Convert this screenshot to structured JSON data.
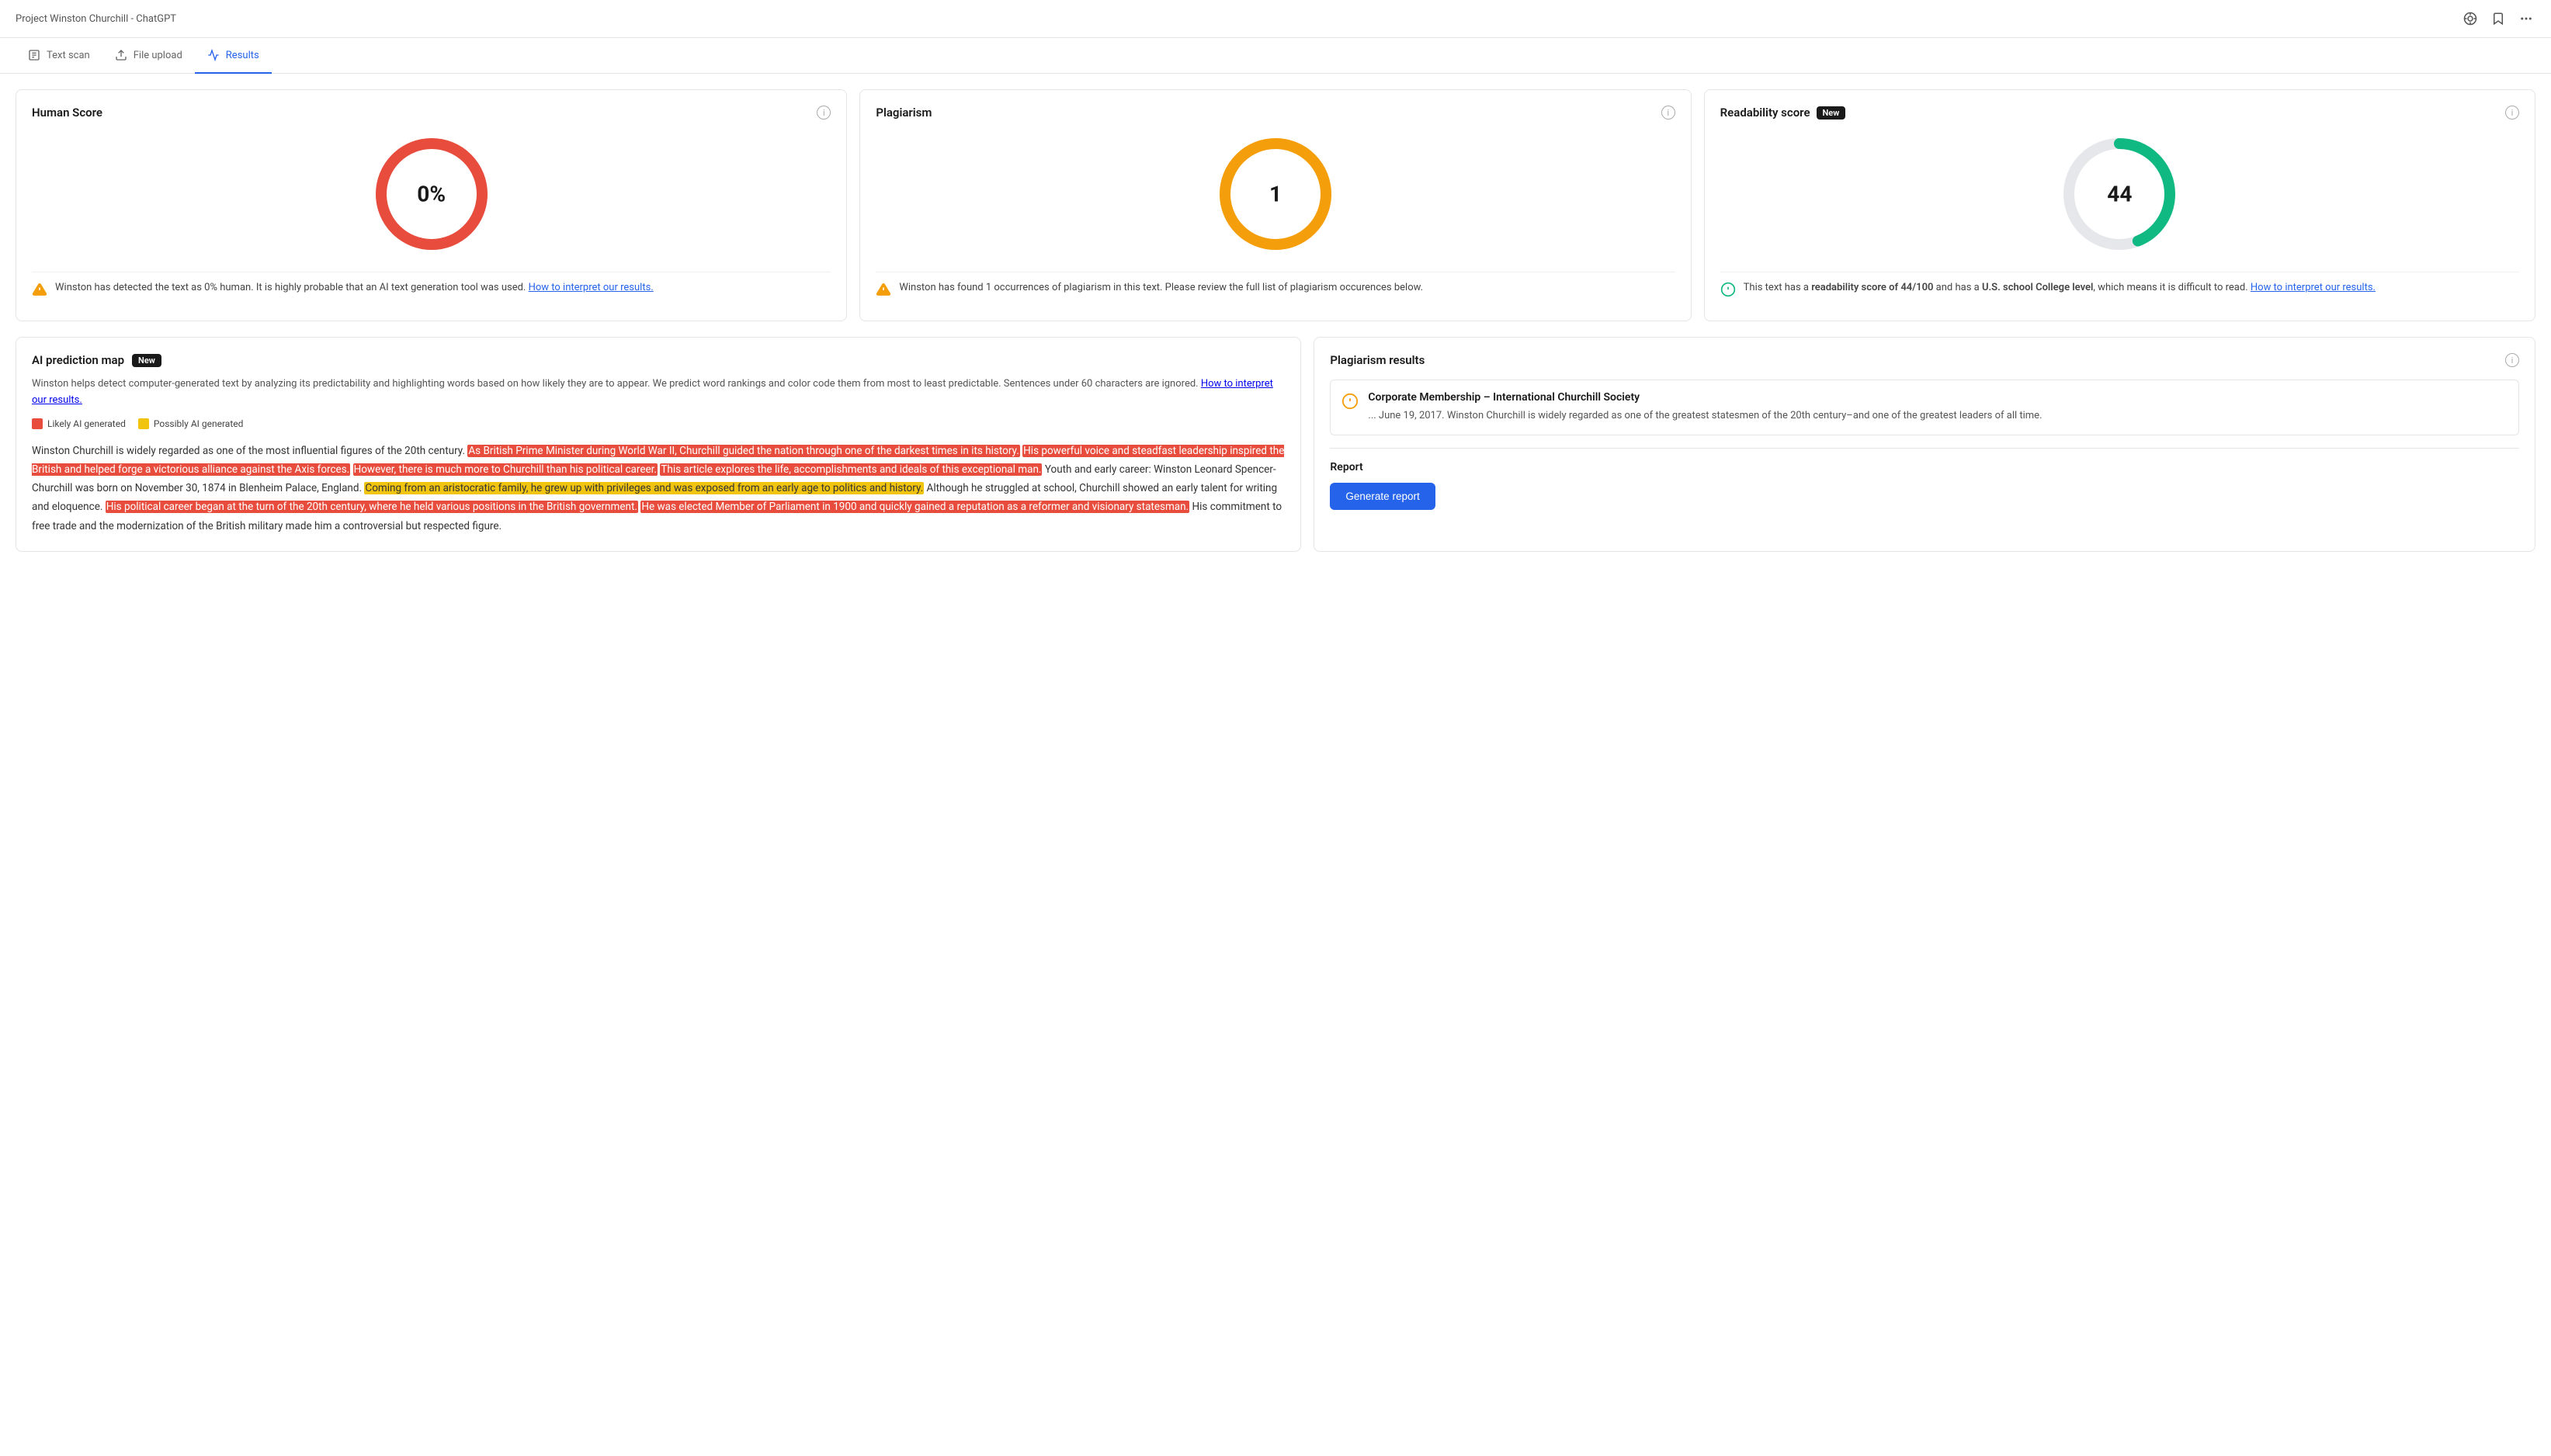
{
  "header": {
    "title": "Project Winston Churchill - ChatGPT",
    "icons": [
      "target-icon",
      "bookmark-icon",
      "more-icon"
    ]
  },
  "nav": {
    "tabs": [
      {
        "id": "text-scan",
        "label": "Text scan",
        "icon": "scan"
      },
      {
        "id": "file-upload",
        "label": "File upload",
        "icon": "upload"
      },
      {
        "id": "results",
        "label": "Results",
        "icon": "results",
        "active": true
      }
    ]
  },
  "human_score": {
    "title": "Human Score",
    "value": "0%",
    "alert_text": "Winston has detected the text as 0% human. It is highly probable that an AI text generation tool was used.",
    "alert_link": "How to interpret our results.",
    "ring_color": "#e74c3c",
    "ring_bg": "#f5d5d5"
  },
  "plagiarism": {
    "title": "Plagiarism",
    "value": "1",
    "alert_text": "Winston has found 1 occurrences of plagiarism in this text. Please review the full list of plagiarism occurences below.",
    "ring_color": "#f59e0b",
    "ring_bg": "#fde8bc"
  },
  "readability": {
    "title": "Readability score",
    "badge": "New",
    "value": "44",
    "alert_text_before": "This text has a ",
    "alert_bold1": "readability score of 44/100",
    "alert_text_mid": " and has a ",
    "alert_bold2": "U.S. school College level",
    "alert_text_after": ", which means it is difficult to read.",
    "alert_link": "How to interpret our results.",
    "ring_color": "#10b981",
    "ring_bg": "#e5e7eb"
  },
  "ai_prediction": {
    "title": "AI prediction map",
    "badge": "New",
    "description": "Winston helps detect computer-generated text by analyzing its predictability and highlighting words based on how likely they are to appear. We predict word rankings and color code them from most to least predictable. Sentences under 60 characters are ignored.",
    "description_link": "How to interpret our results.",
    "legend": [
      {
        "color": "#e74c3c",
        "label": "Likely AI generated"
      },
      {
        "color": "#f1c40f",
        "label": "Possibly AI generated"
      }
    ],
    "text_segments": [
      {
        "type": "normal",
        "text": "Winston Churchill is widely regarded as one of the most influential figures of the 20th century. "
      },
      {
        "type": "red",
        "text": "As British Prime Minister during World War II, Churchill guided the nation through one of the darkest times in its history."
      },
      {
        "type": "normal",
        "text": " "
      },
      {
        "type": "red",
        "text": "His powerful voice and steadfast leadership inspired the British and helped forge a victorious alliance against the Axis forces."
      },
      {
        "type": "normal",
        "text": " "
      },
      {
        "type": "red",
        "text": "However, there is much more to Churchill than his political career."
      },
      {
        "type": "normal",
        "text": " "
      },
      {
        "type": "red",
        "text": "This article explores the life, accomplishments and ideals of this exceptional man."
      },
      {
        "type": "normal",
        "text": " Youth and early career: Winston Leonard Spencer-Churchill was born on November 30, 1874 in Blenheim Palace, England. "
      },
      {
        "type": "yellow",
        "text": "Coming from an aristocratic family, he grew up with privileges and was exposed from an early age to politics and history."
      },
      {
        "type": "normal",
        "text": " Although he struggled at school, Churchill showed an early talent for writing and eloquence. "
      },
      {
        "type": "red",
        "text": "His political career began at the turn of the 20th century, where he held various positions in the British government."
      },
      {
        "type": "normal",
        "text": " "
      },
      {
        "type": "red",
        "text": "He was elected Member of Parliament in 1900 and quickly gained a reputation as a reformer and visionary statesman."
      },
      {
        "type": "normal",
        "text": " His commitment to free trade and the modernization of the British military made him a controversial but respected figure."
      }
    ]
  },
  "plagiarism_results": {
    "title": "Plagiarism results",
    "results": [
      {
        "source_title": "Corporate Membership – International Churchill Society",
        "text": "... June 19, 2017. Winston Churchill is widely regarded as one of the greatest statesmen of the 20th century–and one of the greatest leaders of all time."
      }
    ]
  },
  "report": {
    "title": "Report",
    "button_label": "Generate report"
  }
}
